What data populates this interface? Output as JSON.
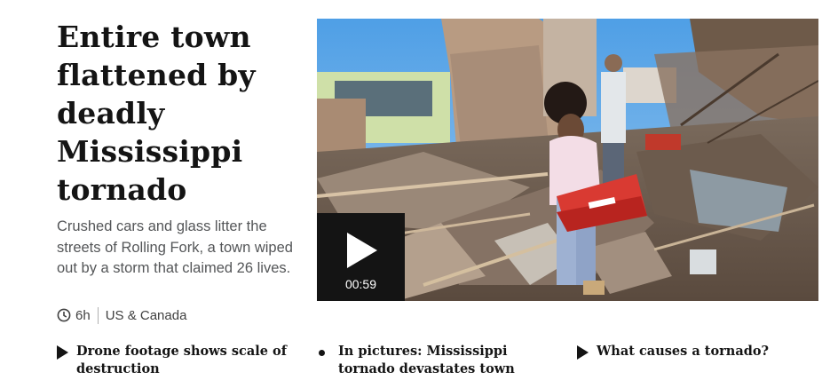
{
  "story": {
    "headline_lines": [
      "Entire town",
      "flattened by",
      "deadly",
      "Mississippi",
      "tornado"
    ],
    "summary": "Crushed cars and glass litter the streets of Rolling Fork, a town wiped out by a storm that claimed 26 lives.",
    "time": "6h",
    "section": "US & Canada"
  },
  "video": {
    "duration": "00:59",
    "play_icon": "play-icon"
  },
  "related": [
    {
      "icon": "play-triangle-icon",
      "lines": [
        "Drone footage shows scale of",
        "destruction"
      ]
    },
    {
      "icon": "bullet-dot-icon",
      "lines": [
        "In pictures: Mississippi",
        "tornado devastates town"
      ]
    },
    {
      "icon": "play-triangle-icon",
      "lines": [
        "What causes a tornado?"
      ]
    }
  ]
}
